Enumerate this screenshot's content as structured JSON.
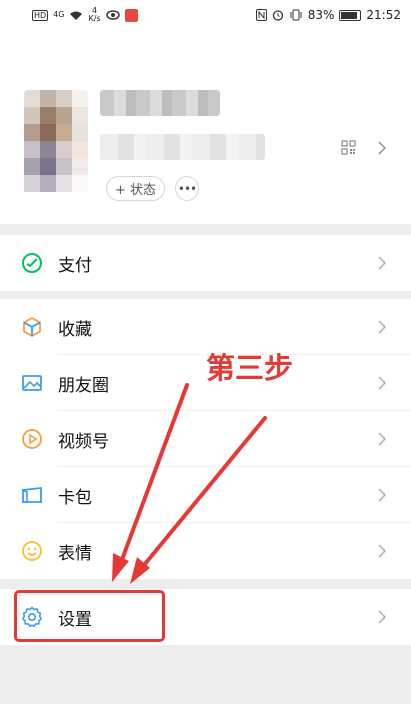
{
  "status_bar": {
    "left_badge": "HD",
    "signal_4g": "4G",
    "speed_value": "4",
    "speed_unit": "K/s",
    "battery": "83%",
    "time": "21:52"
  },
  "profile": {
    "status_label": "+ 状态",
    "more_label": "•••"
  },
  "menu": {
    "pay": "支付",
    "favorites": "收藏",
    "moments": "朋友圈",
    "channels": "视频号",
    "cards": "卡包",
    "stickers": "表情",
    "settings": "设置"
  },
  "annotation": {
    "step_text": "第三步",
    "color": "#e53935"
  },
  "colors": {
    "wechat_green": "#07c160",
    "background": "#ededed"
  }
}
